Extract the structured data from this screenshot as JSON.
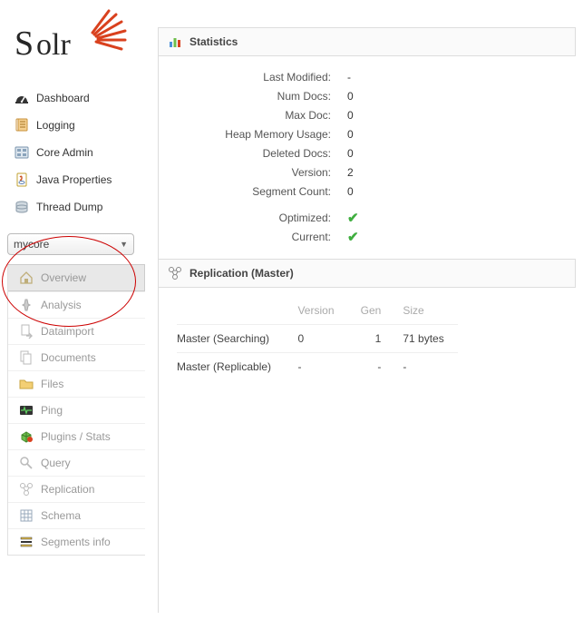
{
  "brand": "Solr",
  "nav": [
    {
      "label": "Dashboard",
      "icon": "dashboard"
    },
    {
      "label": "Logging",
      "icon": "logging"
    },
    {
      "label": "Core Admin",
      "icon": "coreadmin"
    },
    {
      "label": "Java Properties",
      "icon": "javaprops"
    },
    {
      "label": "Thread Dump",
      "icon": "threaddump"
    }
  ],
  "core_selected": "mycore",
  "core_nav": [
    {
      "label": "Overview",
      "icon": "overview",
      "active": true
    },
    {
      "label": "Analysis",
      "icon": "analysis"
    },
    {
      "label": "Dataimport",
      "icon": "dataimport"
    },
    {
      "label": "Documents",
      "icon": "documents"
    },
    {
      "label": "Files",
      "icon": "files"
    },
    {
      "label": "Ping",
      "icon": "ping"
    },
    {
      "label": "Plugins / Stats",
      "icon": "plugins",
      "colored": true
    },
    {
      "label": "Query",
      "icon": "query"
    },
    {
      "label": "Replication",
      "icon": "replication"
    },
    {
      "label": "Schema",
      "icon": "schema"
    },
    {
      "label": "Segments info",
      "icon": "segments"
    }
  ],
  "statistics": {
    "title": "Statistics",
    "rows": [
      {
        "label": "Last Modified:",
        "value": "-"
      },
      {
        "label": "Num Docs:",
        "value": "0"
      },
      {
        "label": "Max Doc:",
        "value": "0"
      },
      {
        "label": "Heap Memory Usage:",
        "value": "0"
      },
      {
        "label": "Deleted Docs:",
        "value": "0"
      },
      {
        "label": "Version:",
        "value": "2"
      },
      {
        "label": "Segment Count:",
        "value": "0"
      }
    ],
    "flags": [
      {
        "label": "Optimized:",
        "ok": true
      },
      {
        "label": "Current:",
        "ok": true
      }
    ]
  },
  "replication": {
    "title": "Replication (Master)",
    "headers": [
      "",
      "Version",
      "Gen",
      "Size"
    ],
    "rows": [
      {
        "label": "Master (Searching)",
        "version": "0",
        "gen": "1",
        "size": "71 bytes"
      },
      {
        "label": "Master (Replicable)",
        "version": "-",
        "gen": "-",
        "size": "-"
      }
    ]
  }
}
